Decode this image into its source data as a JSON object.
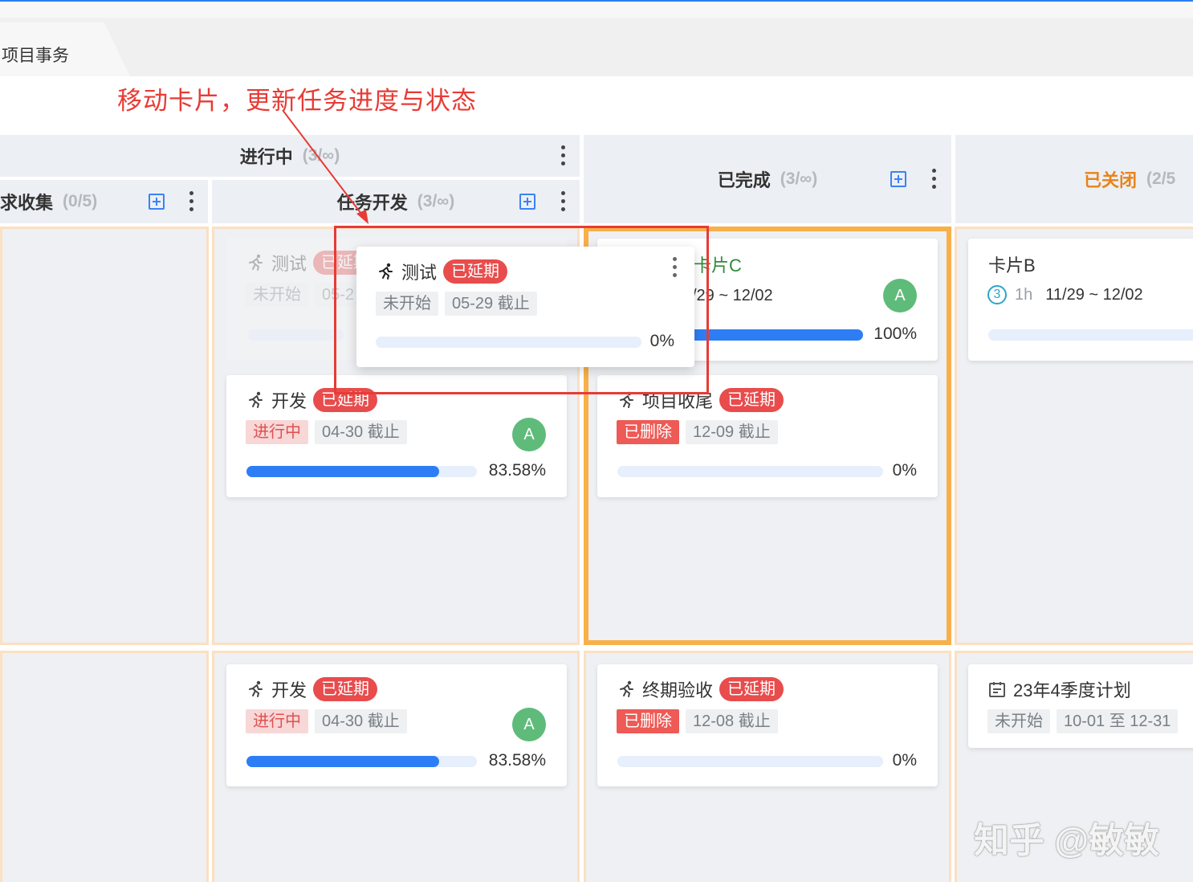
{
  "tab": {
    "label": "项目事务"
  },
  "annotation": "移动卡片，更新任务进度与状态",
  "columns": {
    "in_progress": {
      "title": "进行中",
      "count": "(3/∞)"
    },
    "requirements": {
      "title": "求收集",
      "count": "(0/5)"
    },
    "dev": {
      "title": "任务开发",
      "count": "(3/∞)"
    },
    "done": {
      "title": "已完成",
      "count": "(3/∞)"
    },
    "closed": {
      "title": "已关闭",
      "count": "(2/5"
    }
  },
  "colors": {
    "accent": "#2d7ef5",
    "delayed": "#e84c4c",
    "closed_title": "#e8831a",
    "highlight": "#f7b04a",
    "annotation": "#e83b35",
    "avatar": "#5fbb7a"
  },
  "cards": {
    "ghost_test": {
      "title": "测试",
      "badge": "已延期",
      "status": "未开始",
      "due": "05-2"
    },
    "drag_test": {
      "title": "测试",
      "badge": "已延期",
      "status": "未开始",
      "due": "05-29 截止",
      "progress": 0,
      "pct": "0%"
    },
    "dev1": {
      "title": "开发",
      "badge": "已延期",
      "status": "进行中",
      "due": "04-30 截止",
      "progress": 83.58,
      "pct": "83.58%",
      "avatar": "A"
    },
    "dev2": {
      "title": "开发",
      "badge": "已延期",
      "status": "进行中",
      "due": "04-30 截止",
      "progress": 83.58,
      "pct": "83.58%",
      "avatar": "A"
    },
    "card_c": {
      "title": "卡片C",
      "dates": "/29 ~ 12/02",
      "progress": 100,
      "pct": "100%",
      "avatar": "A"
    },
    "wrapup": {
      "title": "项目收尾",
      "badge": "已延期",
      "status": "已删除",
      "due": "12-09 截止",
      "progress": 0,
      "pct": "0%"
    },
    "acceptance": {
      "title": "终期验收",
      "badge": "已延期",
      "status": "已删除",
      "due": "12-08 截止",
      "progress": 0,
      "pct": "0%"
    },
    "card_b": {
      "title": "卡片B",
      "num": "3",
      "hours": "1h",
      "dates": "11/29 ~ 12/02"
    },
    "plan": {
      "title": "23年4季度计划",
      "status": "未开始",
      "dates": "10-01 至 12-31"
    }
  },
  "icons": [
    "runner-icon",
    "calendar-icon",
    "plus-square-icon",
    "more-vertical-icon",
    "circled-number-icon"
  ],
  "watermark": "知乎 @敏敏"
}
